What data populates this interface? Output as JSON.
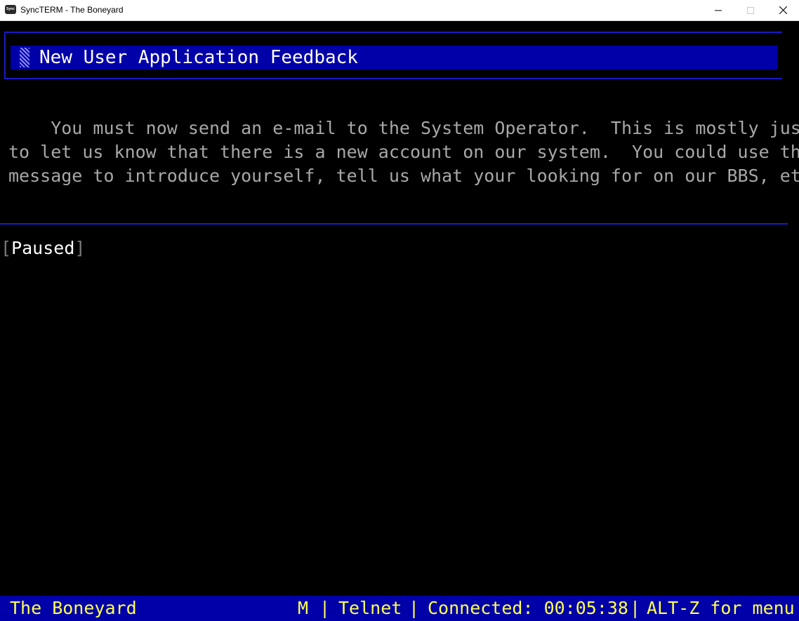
{
  "window": {
    "title": "SyncTERM - The Boneyard",
    "icon": "syncterm-app-icon",
    "icon_label": "Sync",
    "controls": [
      "minimize-icon",
      "maximize-icon",
      "close-icon"
    ]
  },
  "terminal": {
    "header_title": "New User Application Feedback",
    "message_lines": [
      "    You must now send an e-mail to the System Operator.  This is mostly just",
      "to let us know that there is a new account on our system.  You could use this",
      "message to introduce yourself, tell us what your looking for on our BBS, etc."
    ],
    "paused": {
      "open_bracket": "[",
      "label": "Paused",
      "close_bracket": "]"
    }
  },
  "statusbar": {
    "site_name": "The Boneyard",
    "mode": "M",
    "separator": "|",
    "protocol": "Telnet",
    "connected": "Connected: 00:05:38",
    "menu_hint": "ALT-Z for menu"
  },
  "colors": {
    "terminal_bg": "#000000",
    "header_bar": "#0000a8",
    "header_text": "#ffffff",
    "body_text": "#a8a8a8",
    "frame_line": "#1a1ac8",
    "status_bg": "#0000a8",
    "status_text": "#ffff55"
  }
}
